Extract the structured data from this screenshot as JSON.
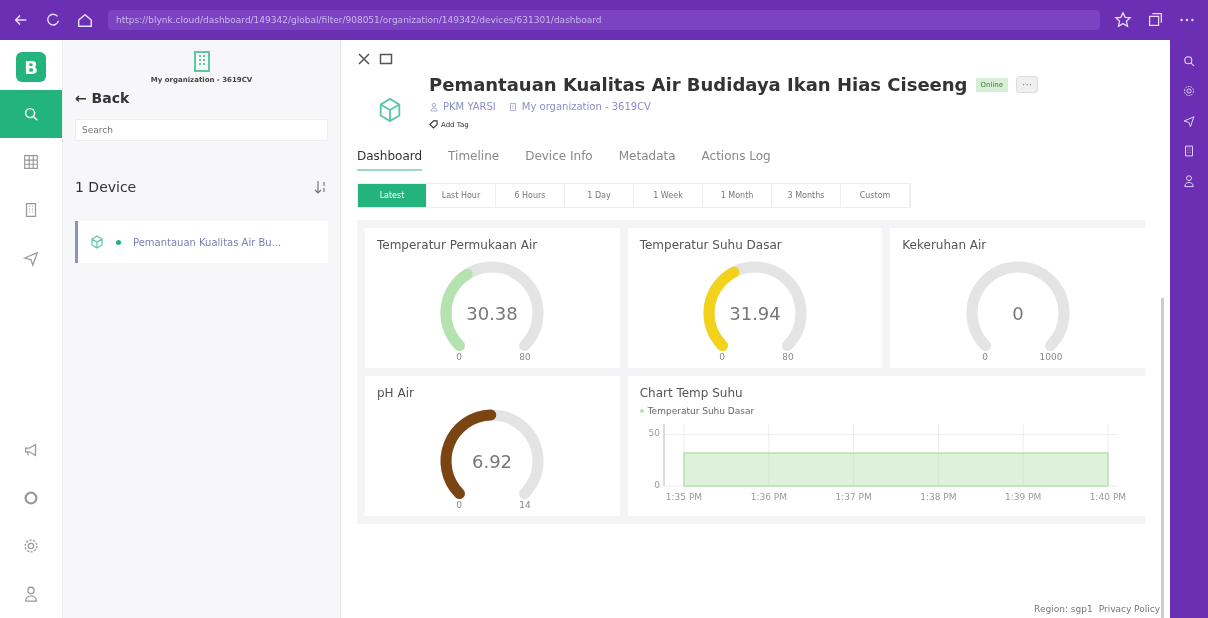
{
  "browser": {
    "url": "https://blynk.cloud/dashboard/149342/global/filter/908051/organization/149342/devices/631301/dashboard"
  },
  "rail": {
    "logo": "B",
    "items": [
      {
        "kind": "search",
        "selected": true
      },
      {
        "kind": "grid",
        "selected": false
      },
      {
        "kind": "building",
        "selected": false
      },
      {
        "kind": "send",
        "selected": false
      }
    ],
    "bottom": [
      {
        "kind": "megaphone"
      },
      {
        "kind": "ring"
      },
      {
        "kind": "gear"
      },
      {
        "kind": "user"
      }
    ]
  },
  "sidebar": {
    "organization": "My organization - 3619CV",
    "back": "← Back",
    "search": {
      "placeholder": "Search"
    },
    "count": "1 Device",
    "devices": [
      {
        "name": "Pemantauan Kualitas Air Bu...",
        "selected": true,
        "online": true
      }
    ]
  },
  "device": {
    "title": "Pemantauan Kualitas Air Budidaya Ikan Hias Ciseeng",
    "status": "Online",
    "owner": "PKM YARSI",
    "organization": "My organization - 3619CV",
    "add_tag": "Add Tag",
    "more": "···"
  },
  "tabs": [
    {
      "label": "Dashboard",
      "selected": true
    },
    {
      "label": "Timeline",
      "selected": false
    },
    {
      "label": "Device Info",
      "selected": false
    },
    {
      "label": "Metadata",
      "selected": false
    },
    {
      "label": "Actions Log",
      "selected": false
    }
  ],
  "ranges": [
    {
      "label": "Latest",
      "selected": true
    },
    {
      "label": "Last Hour",
      "selected": false
    },
    {
      "label": "6 Hours",
      "selected": false
    },
    {
      "label": "1 Day",
      "selected": false
    },
    {
      "label": "1 Week",
      "selected": false
    },
    {
      "label": "1 Month",
      "selected": false
    },
    {
      "label": "3 Months",
      "selected": false
    },
    {
      "label": "Custom",
      "selected": false
    }
  ],
  "widgets": [
    {
      "kind": "gauge",
      "title": "Temperatur Permukaan Air",
      "value": "30.38",
      "min": "0",
      "max": "80",
      "color": "#b5e3b0"
    },
    {
      "kind": "gauge",
      "title": "Temperatur Suhu Dasar",
      "value": "31.94",
      "min": "0",
      "max": "80",
      "color": "#f2d21b"
    },
    {
      "kind": "gauge",
      "title": "Kekeruhan Air",
      "value": "0",
      "min": "0",
      "max": "1000"
    },
    {
      "kind": "gauge",
      "title": "pH Air",
      "value": "6.92",
      "min": "0",
      "max": "14",
      "color": "#7a4513"
    },
    {
      "kind": "chart",
      "title": "Chart Temp Suhu",
      "chart_data": {
        "type": "area",
        "categories": [
          "1:35 PM",
          "1:36 PM",
          "1:37 PM",
          "1:38 PM",
          "1:39 PM",
          "1:40 PM"
        ],
        "series": [
          {
            "name": "Temperatur Suhu Dasar",
            "color": "#b5e3b0",
            "values": [
              32,
              32,
              32,
              32,
              32,
              32
            ]
          }
        ],
        "ylim": [
          0,
          60
        ],
        "yticks": [
          0,
          50
        ],
        "grid": true
      }
    }
  ],
  "footer": {
    "region": "Region: sgp1",
    "privacy": "Privacy Policy"
  }
}
